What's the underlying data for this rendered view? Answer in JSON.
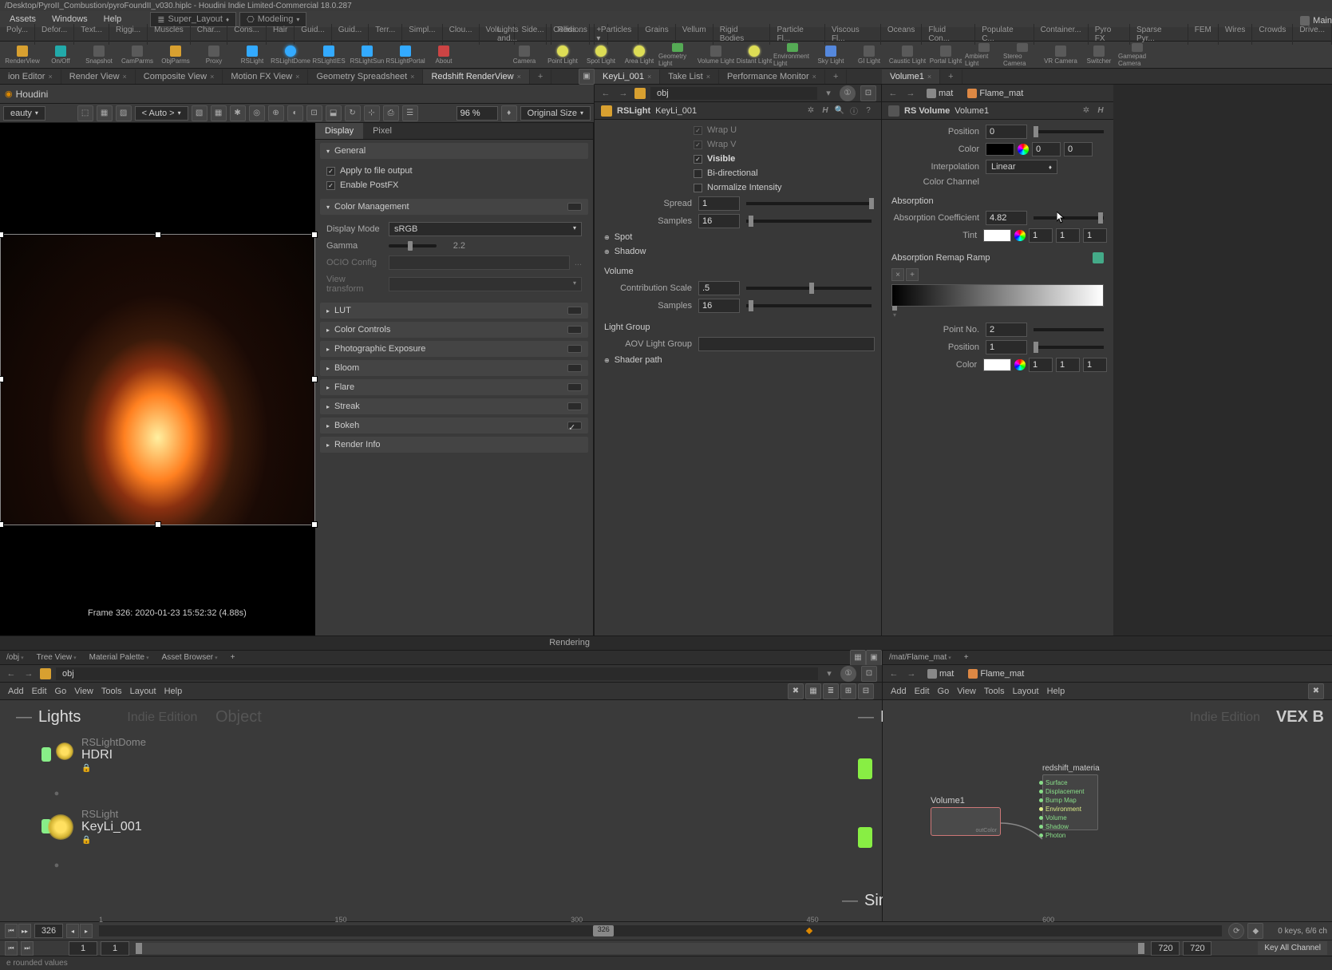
{
  "titlebar": "/Desktop/PyroII_Combustion/pyroFoundII_v030.hiplc - Houdini Indie Limited-Commercial 18.0.287",
  "main_label": "Main",
  "menus": [
    "Assets",
    "Windows",
    "Help"
  ],
  "layout_dd1": "Super_Layout",
  "layout_dd2": "Modeling",
  "shelf_tabs_l": [
    "Poly...",
    "Defor...",
    "Text...",
    "Riggi...",
    "Muscles",
    "Char...",
    "Cons...",
    "Hair",
    "Guid...",
    "Guid...",
    "Terr...",
    "Simpl...",
    "Clou...",
    "Volu...",
    "Side...",
    "Reds..."
  ],
  "shelf_tabs_r": [
    "Lights and...",
    "Collisions",
    "Particles",
    "Grains",
    "Vellum",
    "Rigid Bodies",
    "Particle Fl...",
    "Viscous Fl...",
    "Oceans",
    "Fluid Con...",
    "Populate C...",
    "Container...",
    "Pyro FX",
    "Sparse Pyr...",
    "FEM",
    "Wires",
    "Crowds",
    "Drive..."
  ],
  "shelf_l": [
    "RenderView",
    "On/Off",
    "Snapshot",
    "CamParms",
    "ObjParms",
    "Proxy",
    "RSLight",
    "RSLightDome",
    "RSLightIES",
    "RSLightSun",
    "RSLightPortal",
    "About"
  ],
  "shelf_r": [
    "Camera",
    "Point Light",
    "Spot Light",
    "Area Light",
    "Geometry Light",
    "Volume Light",
    "Distant Light",
    "Environment Light",
    "Sky Light",
    "GI Light",
    "Caustic Light",
    "Portal Light",
    "Ambient Light",
    "Stereo Camera",
    "VR Camera",
    "Switcher",
    "Gamepad Camera"
  ],
  "pane_tabs_l": [
    "ion Editor",
    "Render View",
    "Composite View",
    "Motion FX View",
    "Geometry Spreadsheet",
    "Redshift RenderView"
  ],
  "pane_tabs_r1": [
    "KeyLi_001",
    "Take List",
    "Performance Monitor"
  ],
  "pane_tabs_r2": [
    "Volume1"
  ],
  "rv_header": "Houdini",
  "rv_dropdown_l": "eauty",
  "rv_auto": "< Auto >",
  "rv_zoom": "96 %",
  "rv_size": "Original Size",
  "frame_info": "Frame  326:   2020-01-23  15:52:32  (4.88s)",
  "rendering": "Rendering",
  "display_tabs": [
    "Display",
    "Pixel"
  ],
  "sections": {
    "general": {
      "title": "General",
      "apply": "Apply to file output",
      "postfx": "Enable PostFX"
    },
    "colormgmt": {
      "title": "Color Management",
      "displaymode_l": "Display Mode",
      "displaymode_v": "sRGB",
      "gamma_l": "Gamma",
      "gamma_v": "2.2",
      "ocio_l": "OCIO Config",
      "ocio_v": "...",
      "viewtf_l": "View transform",
      "viewtf_v": ""
    },
    "lut": "LUT",
    "colctl": "Color Controls",
    "photoexp": "Photographic Exposure",
    "bloom": "Bloom",
    "flare": "Flare",
    "streak": "Streak",
    "bokeh": "Bokeh",
    "renderinfo": "Render Info"
  },
  "light_params": {
    "path_arrows": [
      "◄",
      "►"
    ],
    "pin": "obj",
    "type": "RSLight",
    "name": "KeyLi_001",
    "wrapu": "Wrap U",
    "wrapv": "Wrap V",
    "visible": "Visible",
    "bidir": "Bi-directional",
    "normint": "Normalize Intensity",
    "spread_l": "Spread",
    "spread_v": "1",
    "samples_l": "Samples",
    "samples_v": "16",
    "spot": "Spot",
    "shadow": "Shadow",
    "volume": "Volume",
    "contrib_l": "Contribution Scale",
    "contrib_v": ".5",
    "vsamples_l": "Samples",
    "vsamples_v": "16",
    "lightgroup": "Light Group",
    "aovlg_l": "AOV Light Group",
    "aovlg_v": "",
    "shaderpath": "Shader path"
  },
  "vol_params": {
    "type": "RS Volume",
    "name": "Volume1",
    "bread_mat": "mat",
    "bread_node": "Flame_mat",
    "position_l": "Position",
    "position_v": "0",
    "color_l": "Color",
    "color_v": [
      "0",
      "0",
      ""
    ],
    "interp_l": "Interpolation",
    "interp_v": "Linear",
    "colch_l": "Color Channel",
    "absorp_hdr": "Absorption",
    "abscoef_l": "Absorption Coefficient",
    "abscoef_v": "4.82",
    "tint_l": "Tint",
    "tint_v": [
      "1",
      "1",
      "1"
    ],
    "ramp_hdr": "Absorption Remap Ramp",
    "pointno_l": "Point No.",
    "pointno_v": "2",
    "pos2_l": "Position",
    "pos2_v": "1",
    "color2_l": "Color",
    "color2_v": [
      "1",
      "1",
      "1"
    ]
  },
  "net_tabs_l": [
    "/obj",
    "Tree View",
    "Material Palette",
    "Asset Browser"
  ],
  "net_tabs_r": [
    "/mat/Flame_mat"
  ],
  "net_path_l": "obj",
  "net_path_r": {
    "mat": "mat",
    "node": "Flame_mat"
  },
  "net_menu": [
    "Add",
    "Edit",
    "Go",
    "View",
    "Tools",
    "Layout",
    "Help"
  ],
  "indie": "Indie Edition",
  "vex": "VEX B",
  "groups": {
    "lights": "Lights",
    "objects": "Object",
    "base": "Bas",
    "sim": "Sim"
  },
  "light_nodes": [
    {
      "type": "RSLightDome",
      "name": "HDRI"
    },
    {
      "type": "RSLight",
      "name": "KeyLi_001"
    }
  ],
  "mat_node": "Volume1",
  "rsmat_label": "redshift_materia",
  "rsmat_outs": [
    "Surface",
    "Displacement",
    "Bump Map",
    "Environment",
    "Volume",
    "Shadow",
    "Photon"
  ],
  "timeline": {
    "frame": "326",
    "ticks": [
      {
        "v": "1",
        "p": 0
      },
      {
        "v": "150",
        "p": 21
      },
      {
        "v": "300",
        "p": 42
      },
      {
        "v": "326",
        "p": 46
      },
      {
        "v": "450",
        "p": 63
      },
      {
        "v": "600",
        "p": 84
      }
    ],
    "start": "1",
    "first": "1",
    "end1": "720",
    "end2": "720",
    "keys": "0 keys, 6/6 ch",
    "keyall": "Key All Channel"
  },
  "status": "e rounded values"
}
